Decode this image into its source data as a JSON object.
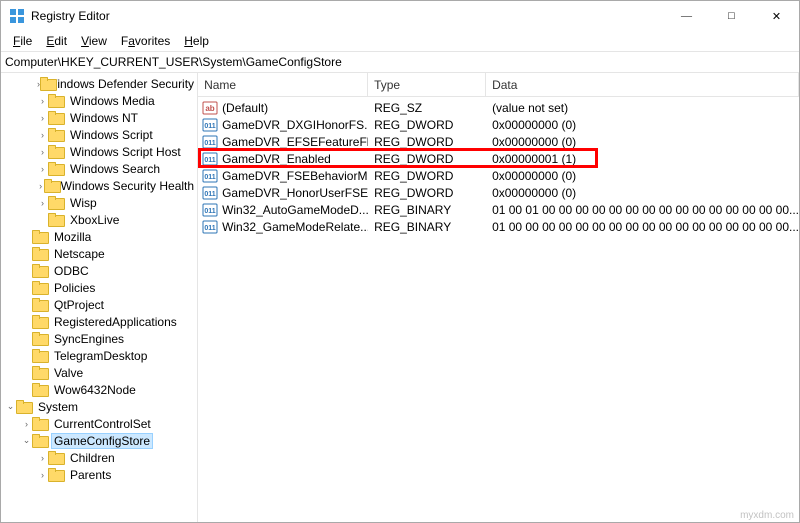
{
  "window": {
    "title": "Registry Editor"
  },
  "menu": {
    "file": "File",
    "edit": "Edit",
    "view": "View",
    "favorites": "Favorites",
    "help": "Help"
  },
  "address": {
    "value": "Computer\\HKEY_CURRENT_USER\\System\\GameConfigStore"
  },
  "tree": [
    {
      "depth": 2,
      "exp": "end",
      "label": "Windows Defender Security Ce",
      "sel": false
    },
    {
      "depth": 2,
      "exp": "closed",
      "label": "Windows Media",
      "sel": false
    },
    {
      "depth": 2,
      "exp": "end",
      "label": "Windows NT",
      "sel": false
    },
    {
      "depth": 2,
      "exp": "end",
      "label": "Windows Script",
      "sel": false
    },
    {
      "depth": 2,
      "exp": "end",
      "label": "Windows Script Host",
      "sel": false
    },
    {
      "depth": 2,
      "exp": "end",
      "label": "Windows Search",
      "sel": false
    },
    {
      "depth": 2,
      "exp": "end",
      "label": "Windows Security Health",
      "sel": false
    },
    {
      "depth": 2,
      "exp": "end",
      "label": "Wisp",
      "sel": false
    },
    {
      "depth": 2,
      "exp": "none",
      "label": "XboxLive",
      "sel": false
    },
    {
      "depth": 1,
      "exp": "none",
      "label": "Mozilla",
      "sel": false
    },
    {
      "depth": 1,
      "exp": "none",
      "label": "Netscape",
      "sel": false
    },
    {
      "depth": 1,
      "exp": "none",
      "label": "ODBC",
      "sel": false
    },
    {
      "depth": 1,
      "exp": "none",
      "label": "Policies",
      "sel": false
    },
    {
      "depth": 1,
      "exp": "none",
      "label": "QtProject",
      "sel": false
    },
    {
      "depth": 1,
      "exp": "none",
      "label": "RegisteredApplications",
      "sel": false
    },
    {
      "depth": 1,
      "exp": "none",
      "label": "SyncEngines",
      "sel": false
    },
    {
      "depth": 1,
      "exp": "none",
      "label": "TelegramDesktop",
      "sel": false
    },
    {
      "depth": 1,
      "exp": "none",
      "label": "Valve",
      "sel": false
    },
    {
      "depth": 1,
      "exp": "none",
      "label": "Wow6432Node",
      "sel": false
    },
    {
      "depth": 0,
      "exp": "open",
      "label": "System",
      "sel": false
    },
    {
      "depth": 1,
      "exp": "closed",
      "label": "CurrentControlSet",
      "sel": false
    },
    {
      "depth": 1,
      "exp": "open",
      "label": "GameConfigStore",
      "sel": true
    },
    {
      "depth": 2,
      "exp": "closed",
      "label": "Children",
      "sel": false
    },
    {
      "depth": 2,
      "exp": "closed",
      "label": "Parents",
      "sel": false
    }
  ],
  "columns": {
    "name": "Name",
    "type": "Type",
    "data": "Data"
  },
  "values": [
    {
      "icon": "string",
      "name": "(Default)",
      "type": "REG_SZ",
      "data": "(value not set)",
      "hl": false
    },
    {
      "icon": "binary",
      "name": "GameDVR_DXGIHonorFS...",
      "type": "REG_DWORD",
      "data": "0x00000000 (0)",
      "hl": false
    },
    {
      "icon": "binary",
      "name": "GameDVR_EFSEFeatureFl...",
      "type": "REG_DWORD",
      "data": "0x00000000 (0)",
      "hl": false
    },
    {
      "icon": "binary",
      "name": "GameDVR_Enabled",
      "type": "REG_DWORD",
      "data": "0x00000001 (1)",
      "hl": true
    },
    {
      "icon": "binary",
      "name": "GameDVR_FSEBehaviorM...",
      "type": "REG_DWORD",
      "data": "0x00000000 (0)",
      "hl": false
    },
    {
      "icon": "binary",
      "name": "GameDVR_HonorUserFSE...",
      "type": "REG_DWORD",
      "data": "0x00000000 (0)",
      "hl": false
    },
    {
      "icon": "binary",
      "name": "Win32_AutoGameModeD...",
      "type": "REG_BINARY",
      "data": "01 00 01 00 00 00 00 00 00 00 00 00 00 00 00 00 00 00...",
      "hl": false
    },
    {
      "icon": "binary",
      "name": "Win32_GameModeRelate...",
      "type": "REG_BINARY",
      "data": "01 00 00 00 00 00 00 00 00 00 00 00 00 00 00 00 00 00...",
      "hl": false
    }
  ],
  "watermark": "myxdm.com"
}
